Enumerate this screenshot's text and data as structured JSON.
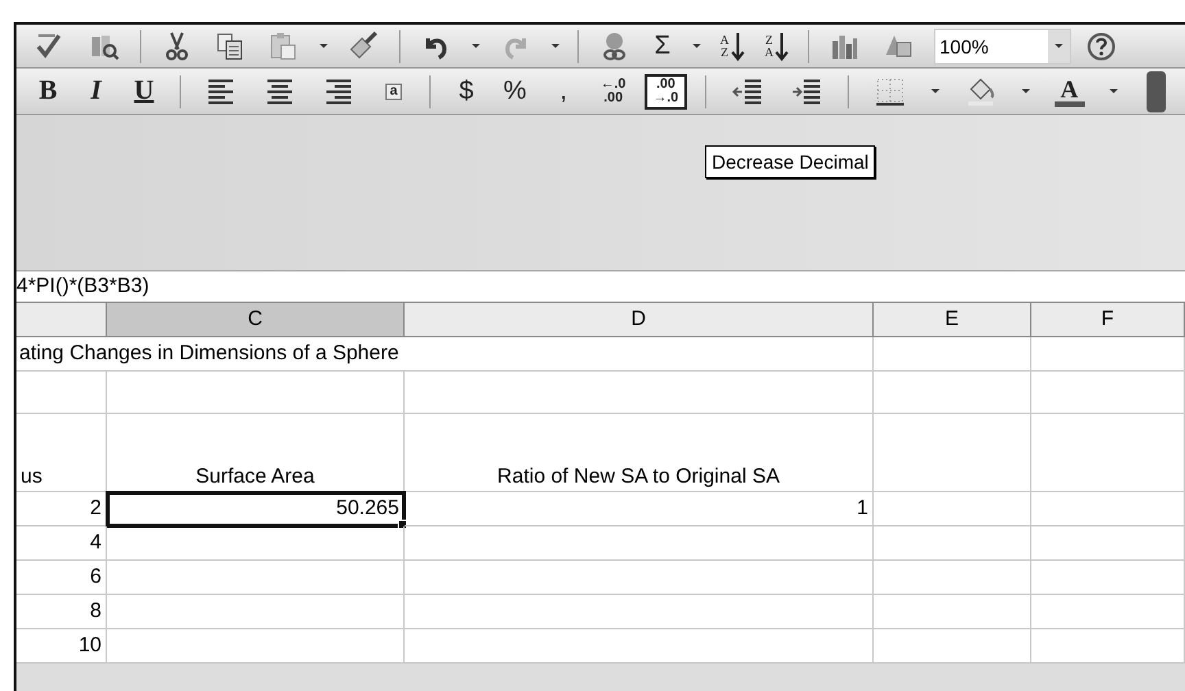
{
  "toolbar_standard": [
    {
      "kind": "spell",
      "dropdown": false,
      "highlighted": false
    },
    {
      "kind": "research",
      "dropdown": false,
      "highlighted": false
    },
    {
      "kind": "sep"
    },
    {
      "kind": "cut",
      "dropdown": false,
      "highlighted": false
    },
    {
      "kind": "copy",
      "dropdown": false,
      "highlighted": false
    },
    {
      "kind": "paste",
      "dropdown": true,
      "highlighted": false
    },
    {
      "kind": "painter",
      "dropdown": false,
      "highlighted": false
    },
    {
      "kind": "sep"
    },
    {
      "kind": "undo",
      "dropdown": true,
      "highlighted": false
    },
    {
      "kind": "redo",
      "dropdown": true,
      "highlighted": false
    },
    {
      "kind": "sep"
    },
    {
      "kind": "link",
      "dropdown": false,
      "highlighted": false
    },
    {
      "kind": "sigma",
      "label": "Σ",
      "dropdown": true,
      "highlighted": false
    },
    {
      "kind": "sort",
      "top": "A",
      "bottom": "Z",
      "dropdown": false,
      "highlighted": false
    },
    {
      "kind": "sort",
      "top": "Z",
      "bottom": "A",
      "dropdown": false,
      "highlighted": false
    },
    {
      "kind": "sep"
    },
    {
      "kind": "chart",
      "dropdown": false,
      "highlighted": false
    },
    {
      "kind": "drawing",
      "dropdown": false,
      "highlighted": false
    },
    {
      "kind": "zoom",
      "value": "100%",
      "dropdown": true
    },
    {
      "kind": "help",
      "dropdown": false,
      "highlighted": false
    }
  ],
  "toolbar_formatting": [
    {
      "kind": "bold",
      "label": "B",
      "dropdown": false,
      "highlighted": false
    },
    {
      "kind": "italic",
      "label": "I",
      "dropdown": false,
      "highlighted": false
    },
    {
      "kind": "underline",
      "label": "U",
      "dropdown": false,
      "highlighted": false
    },
    {
      "kind": "sep"
    },
    {
      "kind": "align_left",
      "dropdown": false,
      "highlighted": false
    },
    {
      "kind": "align_center",
      "dropdown": false,
      "highlighted": false
    },
    {
      "kind": "align_right",
      "dropdown": false,
      "highlighted": false
    },
    {
      "kind": "merge",
      "label": "a",
      "dropdown": false,
      "highlighted": false
    },
    {
      "kind": "sep"
    },
    {
      "kind": "symbol",
      "label": "$",
      "dropdown": false,
      "highlighted": false
    },
    {
      "kind": "symbol",
      "label": "%",
      "dropdown": false,
      "highlighted": false
    },
    {
      "kind": "symbol",
      "label": ",",
      "dropdown": false,
      "highlighted": false
    },
    {
      "kind": "decimal",
      "top": "←.0",
      "bottom": ".00",
      "dropdown": false,
      "highlighted": false
    },
    {
      "kind": "decimal",
      "top": ".00",
      "bottom": "→.0",
      "dropdown": false,
      "highlighted": true
    },
    {
      "kind": "sep"
    },
    {
      "kind": "outdent",
      "dropdown": false,
      "highlighted": false
    },
    {
      "kind": "indent",
      "dropdown": false,
      "highlighted": false
    },
    {
      "kind": "sep"
    },
    {
      "kind": "borders",
      "dropdown": true,
      "highlighted": false
    },
    {
      "kind": "fill",
      "dropdown": true,
      "highlighted": false
    },
    {
      "kind": "fontcolor",
      "label": "A",
      "dropdown": true,
      "highlighted": false
    },
    {
      "kind": "options",
      "dropdown": false,
      "highlighted": false
    }
  ],
  "tooltip": "Decrease Decimal",
  "formula": "4*PI()*(B3*B3)",
  "columns": [
    {
      "selected": false
    },
    {
      "label": "C",
      "selected": true
    },
    {
      "label": "D",
      "selected": false
    },
    {
      "label": "E",
      "selected": false
    },
    {
      "label": "F",
      "selected": false
    }
  ],
  "title_row": "ating Changes in Dimensions of a Sphere",
  "header_row": [
    "us",
    "Surface Area",
    "Ratio of New SA to Original SA"
  ],
  "rows": [
    {
      "cells": [
        {
          "text": "2",
          "selected": false
        },
        {
          "text": "50.265",
          "selected": true
        },
        {
          "text": "1",
          "selected": false
        },
        {
          "selected": false
        },
        {
          "selected": false
        }
      ]
    },
    {
      "cells": [
        {
          "text": "4",
          "selected": false
        },
        {
          "selected": false
        },
        {
          "selected": false
        },
        {
          "selected": false
        },
        {
          "selected": false
        }
      ]
    },
    {
      "cells": [
        {
          "text": "6",
          "selected": false
        },
        {
          "selected": false
        },
        {
          "selected": false
        },
        {
          "selected": false
        },
        {
          "selected": false
        }
      ]
    },
    {
      "cells": [
        {
          "text": "8",
          "selected": false
        },
        {
          "selected": false
        },
        {
          "selected": false
        },
        {
          "selected": false
        },
        {
          "selected": false
        }
      ]
    },
    {
      "cells": [
        {
          "text": "10",
          "selected": false
        },
        {
          "selected": false
        },
        {
          "selected": false
        },
        {
          "selected": false
        },
        {
          "selected": false
        }
      ]
    }
  ]
}
